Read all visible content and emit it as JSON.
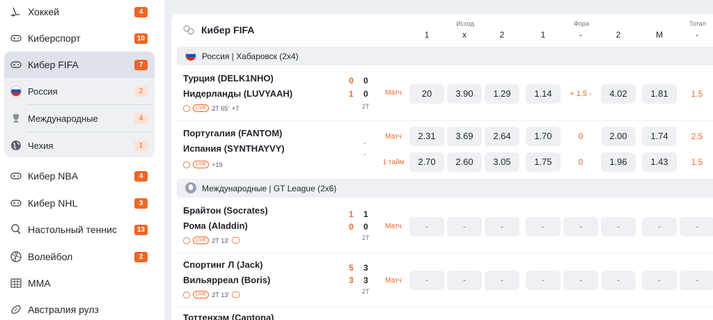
{
  "sidebar": {
    "items": [
      {
        "label": "Хоккей",
        "count": "4",
        "icon": "hockey-icon",
        "style": "orange"
      },
      {
        "label": "Киберспорт",
        "count": "10",
        "icon": "gamepad-icon",
        "style": "orange"
      },
      {
        "label": "Кибер FIFA",
        "count": "7",
        "icon": "gamepad-icon",
        "style": "orange"
      },
      {
        "label": "Россия",
        "count": "2",
        "icon": "flag-russia-icon",
        "style": "pale"
      },
      {
        "label": "Международные",
        "count": "4",
        "icon": "trophy-icon",
        "style": "pale"
      },
      {
        "label": "Чехия",
        "count": "1",
        "icon": "globe-icon",
        "style": "pale"
      },
      {
        "label": "Кибер NBA",
        "count": "4",
        "icon": "gamepad-icon",
        "style": "orange"
      },
      {
        "label": "Кибер NHL",
        "count": "3",
        "icon": "gamepad-icon",
        "style": "orange"
      },
      {
        "label": "Настольный теннис",
        "count": "13",
        "icon": "table-tennis-icon",
        "style": "orange"
      },
      {
        "label": "Волейбол",
        "count": "2",
        "icon": "volleyball-icon",
        "style": "orange"
      },
      {
        "label": "MMA",
        "count": "",
        "icon": "mma-icon",
        "style": "orange"
      },
      {
        "label": "Австралия рулз",
        "count": "",
        "icon": "rugby-icon",
        "style": "orange"
      }
    ]
  },
  "header": {
    "title": "Кибер FIFA",
    "groups": {
      "outcome": "Исход",
      "handicap": "Фора",
      "total": "Тотал"
    },
    "columns": [
      "1",
      "х",
      "2",
      "1",
      "-",
      "2",
      "М",
      "-"
    ]
  },
  "leagues": [
    {
      "name": "Россия | Хабаровск (2х4)",
      "icon": "flag-russia-icon"
    },
    {
      "name": "Международные | GT League (2х6)",
      "icon": "trophy-icon"
    }
  ],
  "matches": [
    {
      "team1": "Турция (DELK1NHO)",
      "team2": "Нидерланды (LUVYAAH)",
      "score1_total": "0",
      "score2_total": "1",
      "score1_period": "0",
      "score2_period": "0",
      "period": "2Т",
      "time": "2Т 65'",
      "extra": "+7",
      "market": "Матч",
      "odds": [
        "20",
        "3.90",
        "1.29",
        "1.14",
        "+ 1.5 -",
        "4.02",
        "1.81",
        "1.5"
      ]
    },
    {
      "team1": "Португалия (FANTOM)",
      "team2": "Испания (SYNTHAYVY)",
      "dash1": "-",
      "dash2": "-",
      "extra": "+19",
      "market1": "Матч",
      "market2": "1 тайм",
      "odds1": [
        "2.31",
        "3.69",
        "2.64",
        "1.70",
        "0",
        "2.00",
        "1.74",
        "2.5"
      ],
      "odds2": [
        "2.70",
        "2.60",
        "3.05",
        "1.75",
        "0",
        "1.96",
        "1.43",
        "1.5"
      ]
    },
    {
      "team1": "Брайтон (Socrates)",
      "team2": "Рома (Aladdin)",
      "score1_total": "1",
      "score2_total": "0",
      "score1_period": "1",
      "score2_period": "0",
      "period": "2Т",
      "time": "2Т 13'",
      "market": "Матч",
      "odds": [
        "-",
        "-",
        "-",
        "-",
        "-",
        "-",
        "-",
        "-"
      ]
    },
    {
      "team1": "Спортинг Л (Jack)",
      "team2": "Вильярреал (Boris)",
      "score1_total": "5",
      "score2_total": "3",
      "score1_period": "3",
      "score2_period": "3",
      "period": "2Т",
      "time": "2Т 13'",
      "market": "Матч",
      "odds": [
        "-",
        "-",
        "-",
        "-",
        "-",
        "-",
        "-",
        "-"
      ]
    },
    {
      "team1": "Тоттенхэм (Cantona)"
    }
  ],
  "colors": {
    "accent": "#f26522",
    "panel": "#ffffff",
    "background": "#eceff4"
  }
}
